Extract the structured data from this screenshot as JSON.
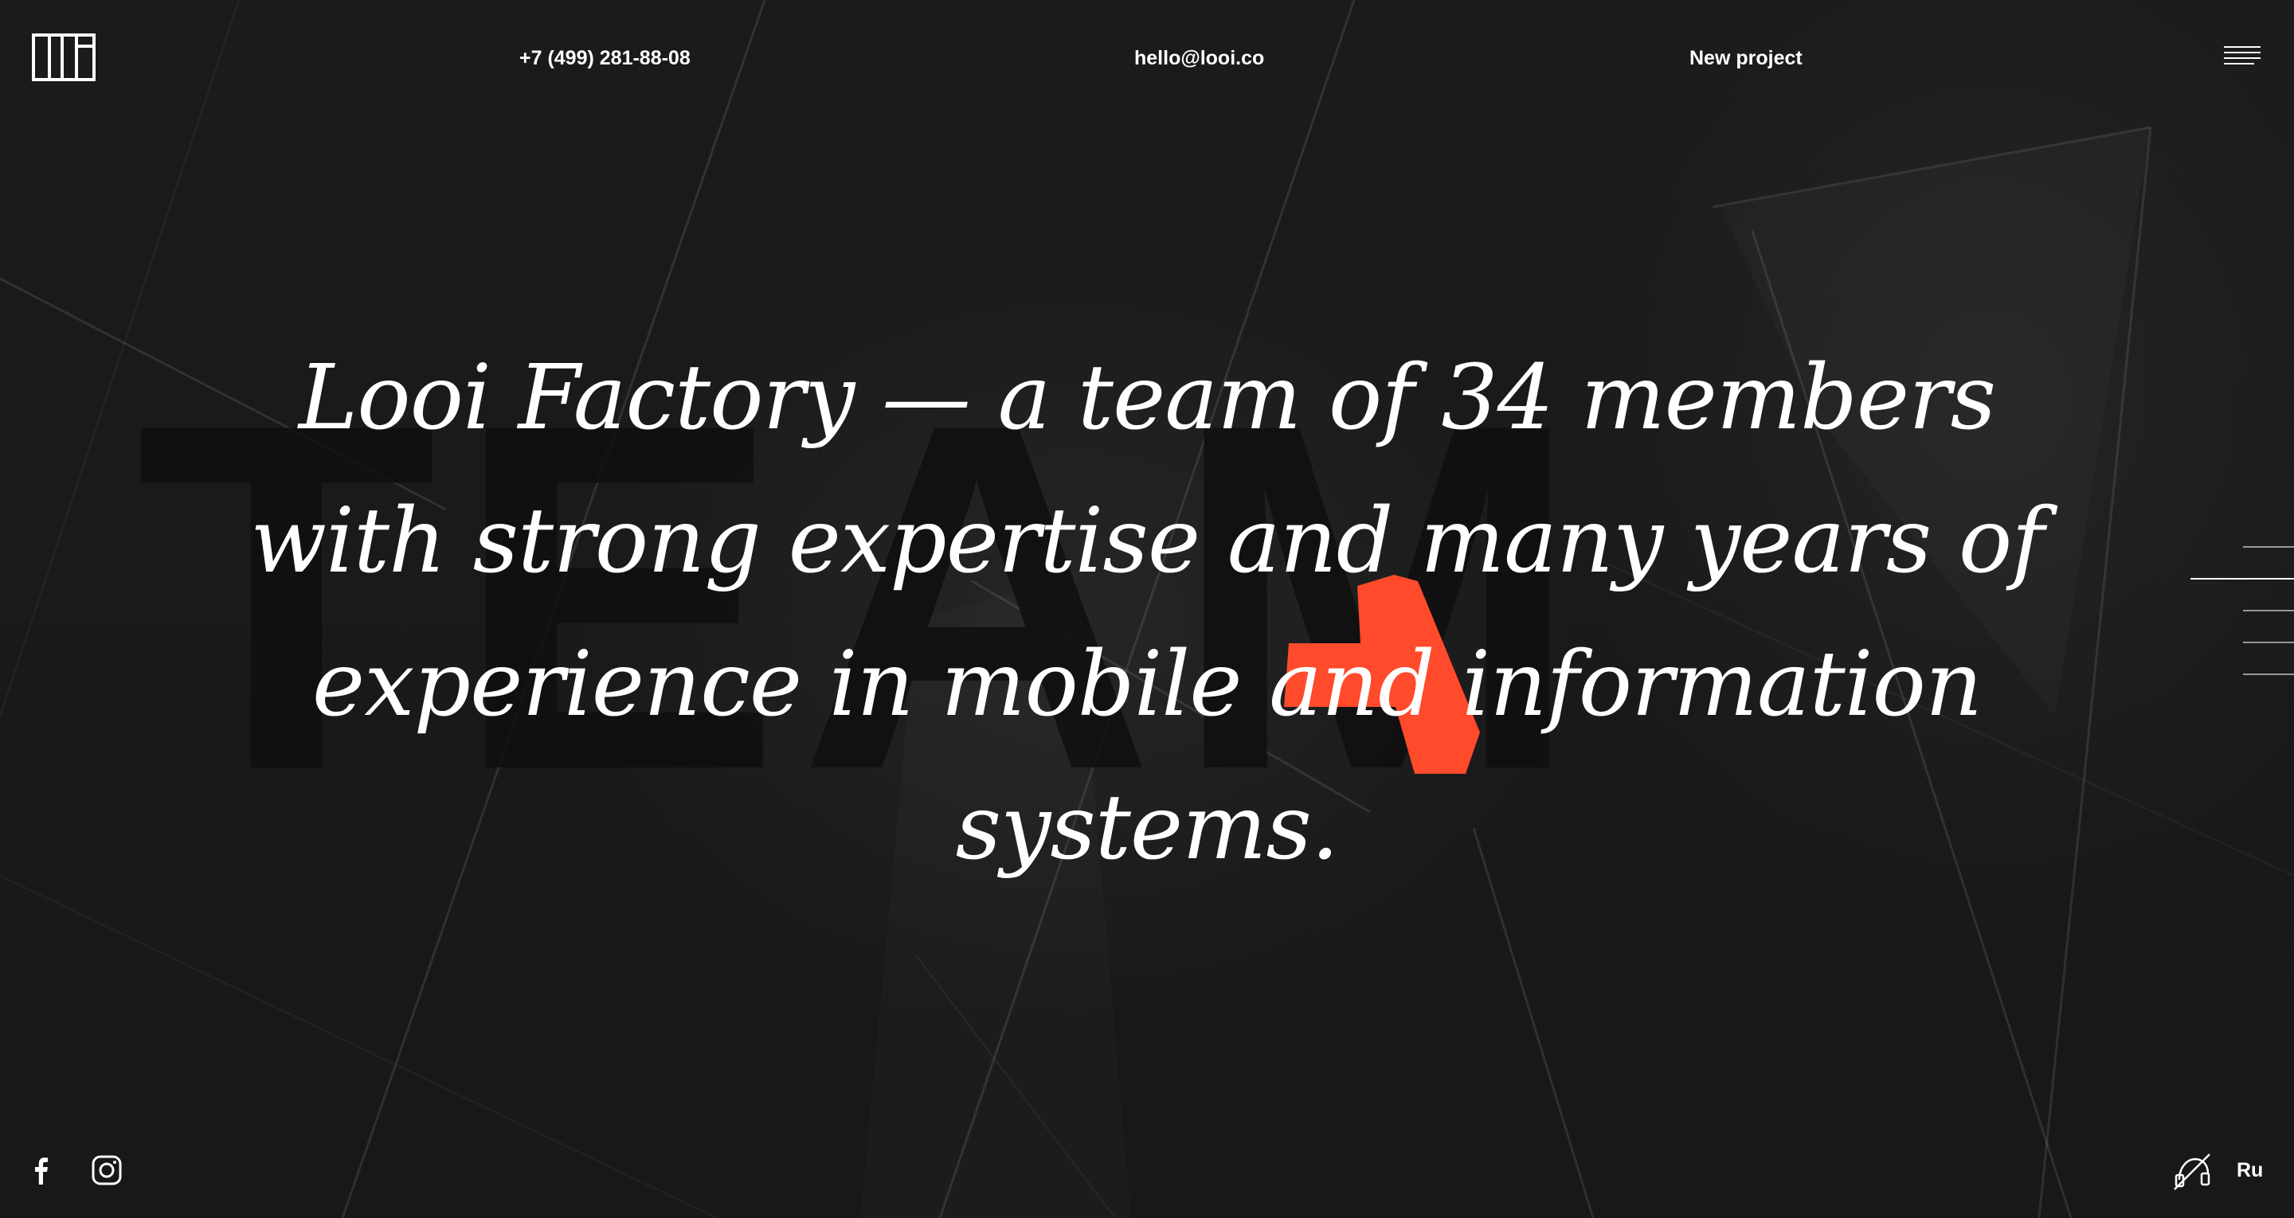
{
  "header": {
    "phone": "+7 (499) 281-88-08",
    "email": "hello@looi.co",
    "new_project": "New project"
  },
  "hero": {
    "background_word": "TEAM",
    "headline": "Looi Factory — a team of 34 members with strong expertise and many years of experience in mobile and information systems."
  },
  "footer": {
    "language": "Ru"
  },
  "icons": {
    "logo": "looi-logo-icon",
    "menu": "hamburger-menu-icon",
    "facebook": "facebook-icon",
    "instagram": "instagram-icon",
    "sound": "sound-off-icon"
  },
  "colors": {
    "background": "#191919",
    "accent": "#ff4a2b",
    "text": "#ffffff"
  }
}
